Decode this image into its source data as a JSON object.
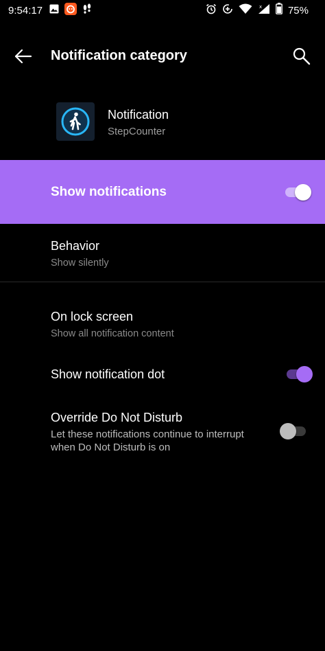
{
  "status_bar": {
    "time": "9:54:17",
    "battery": "75%",
    "icons": [
      "image-icon",
      "notification-app-icon",
      "footprints-icon",
      "alarm-icon",
      "data-saver-icon",
      "wifi-icon",
      "signal-icon",
      "battery-icon"
    ]
  },
  "app_bar": {
    "title": "Notification category",
    "back_icon": "arrow-left-icon",
    "search_icon": "search-icon"
  },
  "app_header": {
    "name": "Notification",
    "subtitle": "StepCounter",
    "icon": "walking-person-icon"
  },
  "show_notifications": {
    "label": "Show notifications",
    "enabled": true
  },
  "behavior": {
    "title": "Behavior",
    "value": "Show silently"
  },
  "lock_screen": {
    "title": "On lock screen",
    "value": "Show all notification content"
  },
  "notification_dot": {
    "title": "Show notification dot",
    "enabled": true
  },
  "override_dnd": {
    "title": "Override Do Not Disturb",
    "description": "Let these notifications continue to interrupt when Do Not Disturb is on",
    "enabled": false
  },
  "colors": {
    "accent": "#a56cf5",
    "background": "#000000",
    "secondary_text": "#8a8a8a"
  }
}
